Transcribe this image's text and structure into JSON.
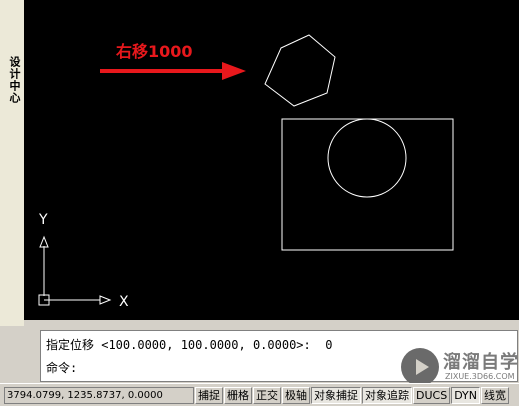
{
  "palette": {
    "title": "设计中心"
  },
  "canvas": {
    "annotation": "右移1000",
    "ucs": {
      "x_label": "X",
      "y_label": "Y"
    },
    "colors": {
      "background": "#000000",
      "lines": "#ffffff",
      "annotation": "#e8181c"
    }
  },
  "command": {
    "line1": "指定位移 <100.0000, 100.0000, 0.0000>:  0",
    "line2": "命令:"
  },
  "watermark": {
    "title": "溜溜自学",
    "url": "ZIXUE.3D66.COM"
  },
  "status": {
    "coordinates": "3794.0799, 1235.8737, 0.0000",
    "toggles": [
      "捕捉",
      "栅格",
      "正交",
      "极轴",
      "对象捕捉",
      "对象追踪",
      "DUCS",
      "DYN",
      "线宽"
    ]
  }
}
